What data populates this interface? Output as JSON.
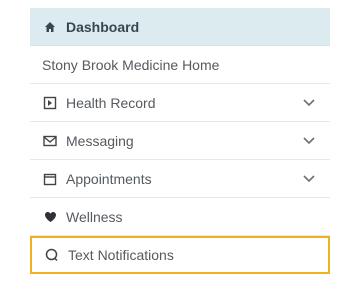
{
  "nav": {
    "dashboard": {
      "label": "Dashboard",
      "icon": "home-icon"
    },
    "home": {
      "label": "Stony Brook Medicine Home"
    },
    "health_record": {
      "label": "Health Record",
      "icon": "document-icon",
      "expandable": true
    },
    "messaging": {
      "label": "Messaging",
      "icon": "envelope-icon",
      "expandable": true
    },
    "appointments": {
      "label": "Appointments",
      "icon": "calendar-icon",
      "expandable": true
    },
    "wellness": {
      "label": "Wellness",
      "icon": "heart-icon"
    },
    "text_notifications": {
      "label": "Text Notifications",
      "icon": "chat-bubble-icon"
    }
  },
  "colors": {
    "active_bg": "#dcebef",
    "highlight_border": "#f2b01e",
    "text": "#555a5f"
  }
}
